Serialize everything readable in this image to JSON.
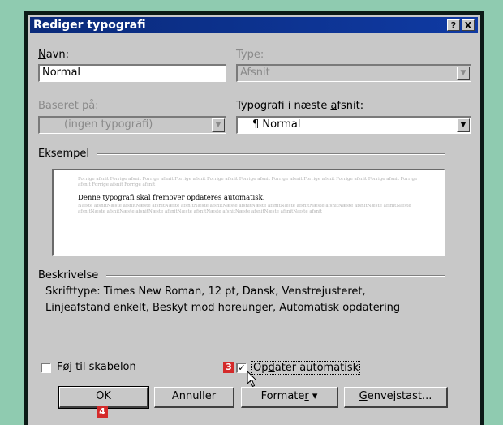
{
  "dialog": {
    "title": "Rediger typografi",
    "help_btn": "?",
    "close_btn": "X"
  },
  "name": {
    "label_underlined": "N",
    "label_rest": "avn:",
    "value": "Normal"
  },
  "type": {
    "label": "Type:",
    "value": "Afsnit"
  },
  "based_on": {
    "label": "Baseret på:",
    "value": "(ingen typografi)"
  },
  "next_style": {
    "label_pre": "Typografi i næste ",
    "label_underlined": "a",
    "label_post": "fsnit:",
    "value": "¶ Normal"
  },
  "preview": {
    "label": "Eksempel",
    "grey_before": "Forrige afsnit Forrige afsnit Forrige afsnit Forrige afsnit Forrige afsnit Forrige afsnit Forrige afsnit Forrige afsnit Forrige afsnit Forrige afsnit Forrige afsnit Forrige afsnit Forrige afsnit",
    "main_text": "Denne typografi skal fremover opdateres automatisk.",
    "grey_after": "Næste afsnitNæste afsnitNæste afsnitNæste afsnitNæste afsnitNæste afsnitNæste afsnitNæste afsnitNæste afsnitNæste afsnitNæste afsnitNæste afsnitNæste afsnitNæste afsnitNæste afsnitNæste afsnitNæste afsnitNæste afsnitNæste afsnitNæste afsnit"
  },
  "description": {
    "label": "Beskrivelse",
    "line1": "Skrifttype: Times New Roman, 12 pt, Dansk, Venstrejusteret,",
    "line2": "Linjeafstand enkelt, Beskyt mod horeunger, Automatisk opdatering"
  },
  "add_to_template": {
    "label_pre": "Føj til ",
    "label_underlined": "s",
    "label_post": "kabelon",
    "checked": false
  },
  "auto_update": {
    "label_pre": "Op",
    "label_underlined": "d",
    "label_post": "ater automatisk",
    "checked": true,
    "check_glyph": "✓"
  },
  "buttons": {
    "ok": "OK",
    "cancel": "Annuller",
    "format_pre": "Formate",
    "format_underlined": "r",
    "format_arrow": "▾",
    "shortcut_underlined": "G",
    "shortcut_rest": "envejstast..."
  },
  "annotations": {
    "step3": "3",
    "step4": "4"
  },
  "colors": {
    "titlebar": "#0f3aa3",
    "step_badge": "#d42a2a",
    "background": "#8fcbb0"
  }
}
